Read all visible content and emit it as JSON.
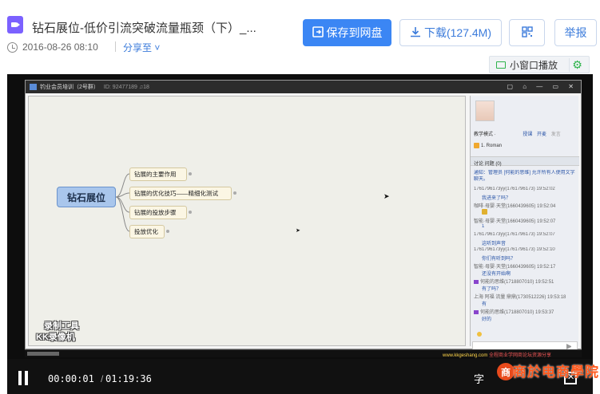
{
  "header": {
    "file_title": "钻石展位-低价引流突破流量瓶颈（下）_...",
    "date": "2016-08-26 08:10",
    "share_label": "分享至",
    "share_chevron": "˅",
    "save_label": "保存到网盘",
    "download_label": "下载(127.4M)",
    "report_label": "举报",
    "mini_player_label": "小窗口播放",
    "icons": {
      "save": "save-to-disk-icon",
      "download": "download-icon",
      "qr": "qr-code-icon",
      "settings": "gear-icon"
    }
  },
  "video": {
    "app": {
      "title": "钓业会员培训（2号群）",
      "meta": "ID: 92477189  ♫18",
      "mindmap": {
        "root": "钻石展位",
        "nodes": [
          "钻展的主要作用",
          "钻展的优化技巧——精细化测试",
          "钻展的投放步骤",
          "投放优化"
        ]
      },
      "panel": {
        "mode_label": "教学模式 ·",
        "mode_tabs": [
          "授课",
          "开麦",
          "发言"
        ],
        "member": "1. Roman",
        "tabs": "讨论   问题 (0)",
        "notice": "通知：管理员 [何能的思维] 允许所有人使用文字聊天。",
        "chat": [
          "1761796173yy(1761796173) 19:52:02",
          "我进来了吗？",
          "咖啡·母婴·天堂(1660439605) 19:52:04",
          "智能·母婴·天堂(1660439605) 19:52:07",
          "1",
          "1761796173yy(1761796173) 19:52:07",
          "这听到声音",
          "1761796173yy(1761796173) 19:52:10",
          "你们有听到吗？",
          "智能·母婴·天堂(1660439605) 19:52:17",
          "还没有开始啊",
          "何能的思维(1718807010) 19:52:51",
          "有了吗？",
          "上海 阿福 流量 鼎鼎(1730512226) 19:53:18",
          "有",
          "何能的思维(1718807010) 19:53:37",
          "好的"
        ]
      },
      "watermark_line1": "录制工具",
      "watermark_line2": "KK录像机",
      "url_note": "www.kkgeshang.com",
      "url_note2": " 全程商业学网商论坛资源分享"
    },
    "time_current": "00:00:01",
    "time_separator": "/",
    "time_total": "01:19:36",
    "subtitle_label": "字",
    "logo_text": "商於电商學院",
    "logo_mark": "商"
  }
}
